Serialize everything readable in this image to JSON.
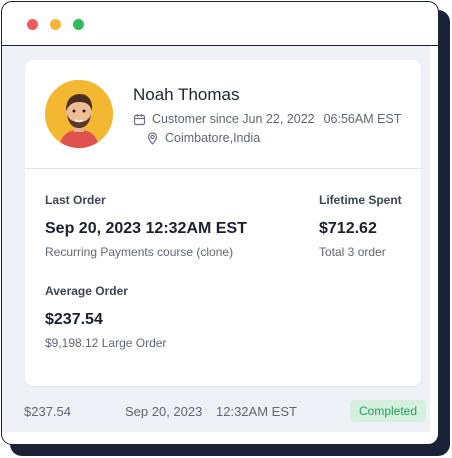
{
  "window": {
    "controls": [
      "close",
      "minimize",
      "maximize"
    ]
  },
  "customer": {
    "name": "Noah Thomas",
    "since_label": "Customer since Jun 22, 2022",
    "since_time": "06:56AM EST",
    "location": "Coimbatore,India",
    "avatar_bg": "#f3b732"
  },
  "stats": {
    "last_order_label": "Last Order",
    "last_order_value": "Sep 20, 2023 12:32AM EST",
    "last_order_sub": "Recurring Payments course (clone)",
    "lifetime_label": "Lifetime Spent",
    "lifetime_value": "$712.62",
    "lifetime_sub": "Total 3 order",
    "average_label": "Average Order",
    "average_value": "$237.54",
    "average_sub": "$9,198.12 Large Order"
  },
  "order_row": {
    "amount": "$237.54",
    "date": "Sep 20, 2023",
    "time": "12:32AM EST",
    "status": "Completed",
    "status_color": "#20a157"
  }
}
